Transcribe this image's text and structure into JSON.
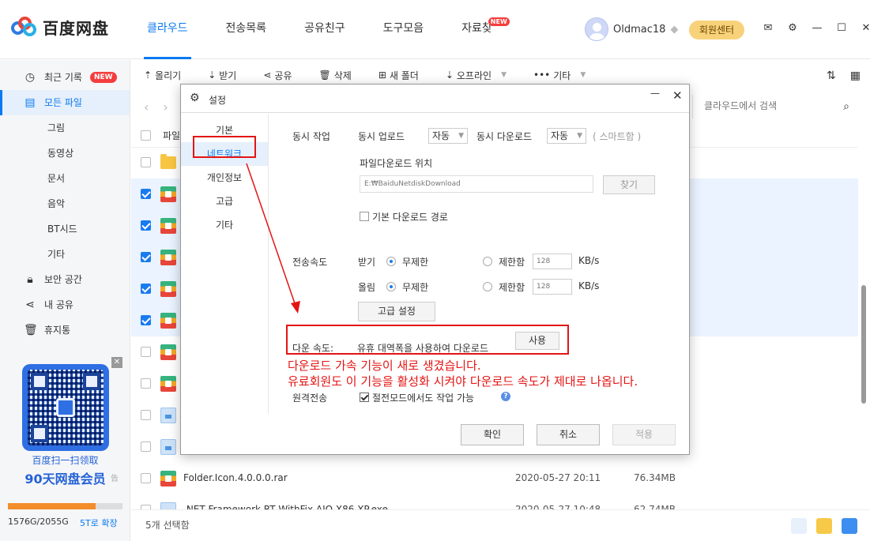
{
  "app": {
    "logo_text": "百度网盘",
    "nav": [
      {
        "label": "클라우드",
        "active": true
      },
      {
        "label": "전송목록"
      },
      {
        "label": "공유친구"
      },
      {
        "label": "도구모음"
      },
      {
        "label": "자료찾",
        "badge": "NEW"
      }
    ],
    "user": {
      "name": "Oldmac18"
    },
    "vip_button": "회원센터"
  },
  "sidebar": {
    "items": [
      {
        "label": "최근 기록",
        "icon": "clock-icon",
        "badge": "NEW"
      },
      {
        "label": "모든 파일",
        "icon": "file-icon",
        "active": true
      },
      {
        "label": "그림"
      },
      {
        "label": "동영상"
      },
      {
        "label": "문서"
      },
      {
        "label": "음악"
      },
      {
        "label": "BT시드"
      },
      {
        "label": "기타"
      },
      {
        "label": "보안 공간",
        "icon": "lock-icon"
      },
      {
        "label": "내 공유",
        "icon": "share-icon"
      },
      {
        "label": "휴지통",
        "icon": "trash-icon"
      }
    ],
    "promo_line1": "百度扫一扫领取",
    "promo_line2": "90天网盘会员",
    "ad_tag": "告",
    "storage_text": "1576G/2055G",
    "storage_used_fraction": 0.767,
    "expand_label": "5T로 확장"
  },
  "toolbar": {
    "upload": "올리기",
    "download": "받기",
    "share": "공유",
    "delete": "삭제",
    "new_folder": "새 폴더",
    "offline": "오프라인",
    "more": "기타",
    "search_placeholder": "클라우드에서 검색",
    "header_col": "파일"
  },
  "files": [
    {
      "name": "",
      "type": "folder",
      "checked": false
    },
    {
      "name": "",
      "type": "rar",
      "checked": true
    },
    {
      "name": "",
      "type": "rar",
      "checked": true
    },
    {
      "name": "",
      "type": "rar",
      "checked": true
    },
    {
      "name": "",
      "type": "rar",
      "checked": true
    },
    {
      "name": "",
      "type": "rar",
      "checked": true
    },
    {
      "name": "",
      "type": "rar",
      "checked": false
    },
    {
      "name": "",
      "type": "rar",
      "checked": false
    },
    {
      "name": "",
      "type": "exe",
      "checked": false
    },
    {
      "name": "",
      "type": "exe",
      "checked": false
    },
    {
      "name": "Folder.Icon.4.0.0.0.rar",
      "date": "2020-05-27 20:11",
      "size": "76.34MB",
      "type": "rar",
      "checked": false
    },
    {
      "name": ".NET Framework RT WithFix  AIO  X86  XP.exe",
      "date": "2020-05-27 10:48",
      "size": "62.74MB",
      "type": "exe",
      "checked": false
    }
  ],
  "status": {
    "selected_text": "5개 선택함"
  },
  "dialog": {
    "title": "설정",
    "nav": [
      "기본",
      "네트워크",
      "개인정보",
      "고급",
      "기타"
    ],
    "concurrent_label": "동시 작업",
    "concurrent_upload_label": "동시 업로드",
    "concurrent_upload_value": "자동",
    "concurrent_download_label": "동시 다운로드",
    "concurrent_download_value": "자동",
    "smart_label": "( 스마트함 )",
    "download_location_label": "파일다운로드 위치",
    "download_path": "E:₩BaiduNetdiskDownload",
    "browse_button": "찾기",
    "default_path_label": "기본 다운로드 경로",
    "speed_label": "전송속도",
    "download_row_label": "받기",
    "upload_row_label": "올림",
    "unlimited_label": "무제한",
    "limited_label": "제한함",
    "limit_value": "128",
    "unit": "KB/s",
    "advanced_button": "고급 설정",
    "dl_speed_label": "다운 속도:",
    "dl_speed_desc": "유휴 대역폭을 사용하여 다운로드",
    "use_button": "사용",
    "remote_label": "원격전송",
    "power_save_label": "절전모드에서도 작업 가능",
    "ok": "확인",
    "cancel": "취소",
    "apply": "적용"
  },
  "annotations": {
    "line1": "다운로드 가속 기능이 새로 생겼습니다.",
    "line2": "유료회원도 이 기능을 활성화 시켜야 다운로드 속도가 제대로 나옵니다."
  }
}
